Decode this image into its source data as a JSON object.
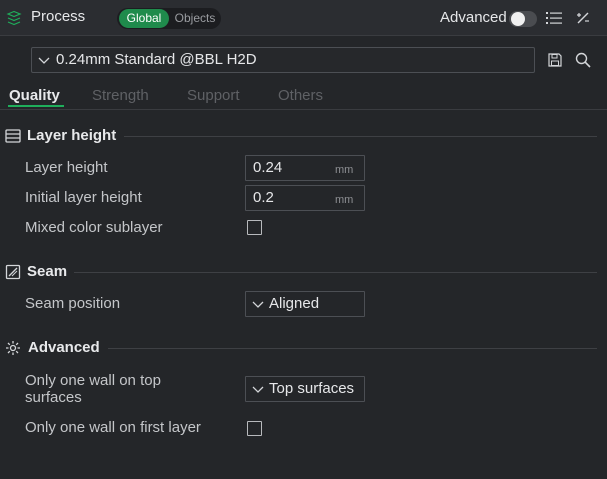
{
  "header": {
    "title": "Process",
    "seg_global": "Global",
    "seg_objects": "Objects",
    "advanced_label": "Advanced",
    "advanced_on": false,
    "accent": "#1f8b4c"
  },
  "preset": {
    "value": "0.24mm Standard @BBL H2D"
  },
  "tabs": [
    {
      "label": "Quality",
      "active": true
    },
    {
      "label": "Strength",
      "active": false
    },
    {
      "label": "Support",
      "active": false
    },
    {
      "label": "Others",
      "active": false
    }
  ],
  "sections": {
    "layer_height": {
      "title": "Layer height",
      "icon": "layer-height-icon",
      "layer_height_label": "Layer height",
      "layer_height_value": "0.24",
      "layer_height_unit": "mm",
      "initial_label": "Initial layer height",
      "initial_value": "0.2",
      "initial_unit": "mm",
      "mixed_label": "Mixed color sublayer",
      "mixed_checked": false
    },
    "seam": {
      "title": "Seam",
      "icon": "seam-icon",
      "position_label": "Seam position",
      "position_value": "Aligned"
    },
    "advanced": {
      "title": "Advanced",
      "icon": "advanced-gear-icon",
      "one_wall_top_label": "Only one wall on top surfaces",
      "one_wall_top_line1": "Only one wall on top",
      "one_wall_top_line2": "surfaces",
      "one_wall_top_value": "Top surfaces",
      "one_wall_first_label": "Only one wall on first layer",
      "one_wall_first_checked": false
    }
  }
}
